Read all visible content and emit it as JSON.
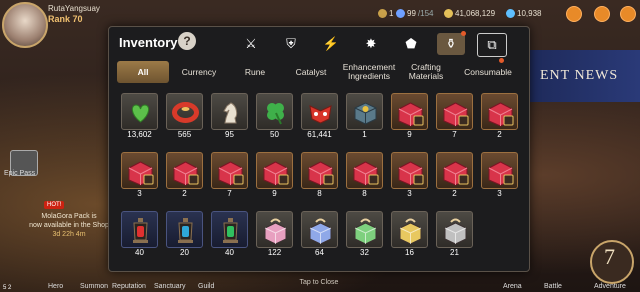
{
  "player": {
    "name": "RutaYangsuay",
    "rank": "Rank 70"
  },
  "resources": [
    {
      "name": "stamina",
      "value": "1",
      "color": "#c9a14a"
    },
    {
      "name": "energy",
      "value": "99",
      "suffix": "/154",
      "color": "#6fa0ff"
    },
    {
      "name": "gold",
      "value": "41,068,129",
      "color": "#e5c15a"
    },
    {
      "name": "gems",
      "value": "10,938",
      "color": "#5fc0ff"
    }
  ],
  "inventory": {
    "title": "Inventory",
    "help": "?",
    "icon_tabs": [
      {
        "icon": "hourglass-sword-icon",
        "glyph": "⚔"
      },
      {
        "icon": "crossed-shield-icon",
        "glyph": "⛨"
      },
      {
        "icon": "lightning-icon",
        "glyph": "⚡"
      },
      {
        "icon": "spark-burst-icon",
        "glyph": "✸"
      },
      {
        "icon": "material-pile-icon",
        "glyph": "⬟"
      },
      {
        "icon": "bag-icon",
        "glyph": "⚱",
        "active": true,
        "badge": true
      },
      {
        "icon": "card-box-icon",
        "glyph": "⧉"
      }
    ],
    "categories": [
      {
        "label": "All",
        "active": true
      },
      {
        "label": "Currency"
      },
      {
        "label": "Rune"
      },
      {
        "label": "Catalyst"
      },
      {
        "label": "Enhancement Ingredients"
      },
      {
        "label": "Crafting Materials"
      },
      {
        "label": "Consumable",
        "badge": true
      }
    ],
    "rows": [
      [
        {
          "icon": "green-heart-icon",
          "count": "13,602"
        },
        {
          "icon": "red-ring-icon",
          "count": "565"
        },
        {
          "icon": "chess-knight-icon",
          "count": "95"
        },
        {
          "icon": "clover-icon",
          "count": "50"
        },
        {
          "icon": "red-mask-icon",
          "count": "61,441"
        },
        {
          "icon": "lucky-box-icon",
          "count": "1"
        },
        {
          "icon": "red-chest-icon",
          "count": "9",
          "rare": true
        },
        {
          "icon": "red-chest-icon",
          "count": "7",
          "rare": true
        },
        {
          "icon": "red-chest-icon",
          "count": "2",
          "rare": true
        }
      ],
      [
        {
          "icon": "red-chest-icon",
          "count": "3",
          "rare": true
        },
        {
          "icon": "red-chest-icon",
          "count": "2",
          "rare": true
        },
        {
          "icon": "red-chest-icon",
          "count": "7",
          "rare": true
        },
        {
          "icon": "red-chest-icon",
          "count": "9",
          "rare": true
        },
        {
          "icon": "red-chest-icon",
          "count": "8",
          "rare": true
        },
        {
          "icon": "red-chest-icon",
          "count": "8",
          "rare": true
        },
        {
          "icon": "red-chest-icon",
          "count": "3",
          "rare": true
        },
        {
          "icon": "red-chest-icon",
          "count": "2",
          "rare": true
        },
        {
          "icon": "red-chest-icon",
          "count": "3",
          "rare": true
        }
      ],
      [
        {
          "icon": "red-lantern-icon",
          "count": "40",
          "color": "#e03030",
          "blue": true
        },
        {
          "icon": "blue-lantern-icon",
          "count": "20",
          "color": "#2fa8d8",
          "blue": true
        },
        {
          "icon": "green-lantern-icon",
          "count": "40",
          "color": "#30c060",
          "blue": true
        },
        {
          "icon": "pink-gift-box-icon",
          "count": "122",
          "color": "#e8a0c0"
        },
        {
          "icon": "blue-gift-box-icon",
          "count": "64",
          "color": "#8fa8e8"
        },
        {
          "icon": "green-gift-box-icon",
          "count": "32",
          "color": "#7ed07e"
        },
        {
          "icon": "gold-gift-box-icon",
          "count": "16",
          "color": "#e8c860"
        },
        {
          "icon": "dark-gift-box-icon",
          "count": "21",
          "color": "#c0c0c0"
        }
      ]
    ],
    "close_hint": "Tap to Close"
  },
  "side": {
    "epic_pass": "Epic Pass",
    "hot": "HOT!",
    "promo_line1": "MolaGora Pack is",
    "promo_line2": "now available in the Shop",
    "promo_time": "3d 22h 4m"
  },
  "nav": [
    "Hero",
    "Summon",
    "Reputation",
    "Sanctuary",
    "Guild",
    "Arena",
    "Battle",
    "Adventure"
  ],
  "banner": "ENT NEWS",
  "adventure_number": "7",
  "corner_text": "5 2"
}
